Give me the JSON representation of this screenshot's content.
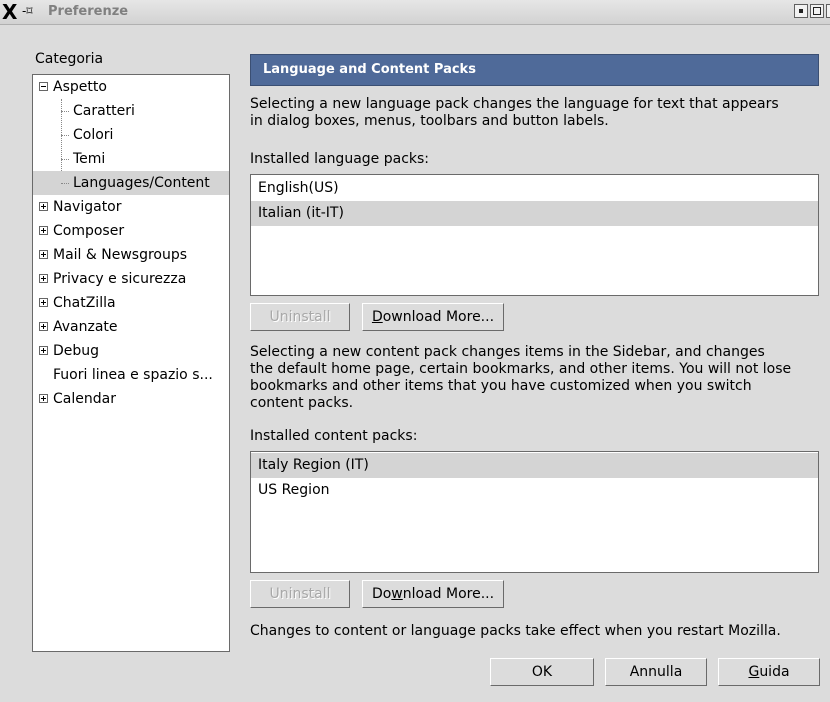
{
  "window": {
    "title": "Preferenze",
    "close_glyph": "×"
  },
  "sidebar": {
    "label": "Categoria",
    "items": [
      {
        "label": "Aspetto",
        "state": "expanded"
      },
      {
        "label": "Caratteri"
      },
      {
        "label": "Colori"
      },
      {
        "label": "Temi"
      },
      {
        "label": "Languages/Content",
        "selected": true
      },
      {
        "label": "Navigator",
        "state": "collapsed"
      },
      {
        "label": "Composer",
        "state": "collapsed"
      },
      {
        "label": "Mail & Newsgroups",
        "state": "collapsed"
      },
      {
        "label": "Privacy e sicurezza",
        "state": "collapsed"
      },
      {
        "label": "ChatZilla",
        "state": "collapsed"
      },
      {
        "label": "Avanzate",
        "state": "collapsed"
      },
      {
        "label": "Debug",
        "state": "collapsed"
      },
      {
        "label": "Fuori linea e spazio s..."
      },
      {
        "label": "Calendar",
        "state": "collapsed"
      }
    ]
  },
  "panel": {
    "header": "Language and Content Packs",
    "lang_desc_1": "Selecting a new language pack changes the language for text that appears",
    "lang_desc_2": "in dialog boxes, menus, toolbars and button labels.",
    "lang_label": "Installed language packs:",
    "lang_items": [
      "English(US)",
      "Italian (it-IT)"
    ],
    "uninstall_label": "Uninstall",
    "download_pre": "",
    "download_mnem": "D",
    "download_post": "ownload More...",
    "content_desc_1": "Selecting a new content pack changes items in the Sidebar, and changes",
    "content_desc_2": "the default home page, certain bookmarks, and other items. You will not lose",
    "content_desc_3": "bookmarks and other items that you have customized when you switch",
    "content_desc_4": "content packs.",
    "content_label": "Installed content packs:",
    "content_items": [
      "Italy Region (IT)",
      "US Region"
    ],
    "uninstall2_label": "Uninstall",
    "download2_pre": "Do",
    "download2_mnem": "w",
    "download2_post": "nload More...",
    "footer_note": "Changes to content or language packs take effect when you restart Mozilla."
  },
  "buttons": {
    "ok": "OK",
    "cancel": "Annulla",
    "help_mnem": "G",
    "help_rest": "uida"
  }
}
